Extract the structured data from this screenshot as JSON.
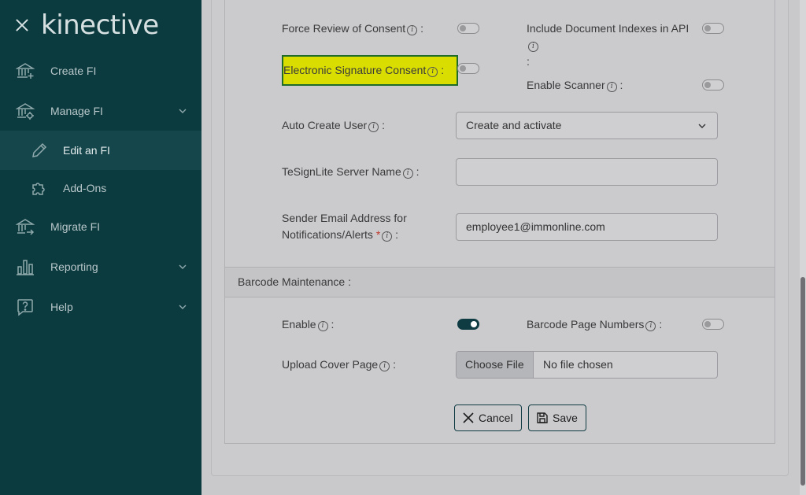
{
  "sidebar": {
    "logo": "kinective",
    "items": [
      {
        "label": "Create FI"
      },
      {
        "label": "Manage FI"
      },
      {
        "label": "Edit an FI"
      },
      {
        "label": "Add-Ons"
      },
      {
        "label": "Migrate FI"
      },
      {
        "label": "Reporting"
      },
      {
        "label": "Help"
      }
    ]
  },
  "form": {
    "force_review_label": "Force Review of Consent",
    "force_review_enabled": false,
    "include_doc_indexes_label": "Include Document Indexes in API",
    "include_doc_indexes_enabled": false,
    "esig_consent_label": "Electronic Signature Consent",
    "esig_consent_enabled": false,
    "enable_scanner_label": "Enable Scanner",
    "enable_scanner_enabled": false,
    "auto_create_user_label": "Auto Create User",
    "auto_create_user_value": "Create and activate",
    "tesignlite_label": "TeSignLite Server Name",
    "tesignlite_value": "",
    "sender_email_label_line1": "Sender Email Address for",
    "sender_email_label_line2": "Notifications/Alerts",
    "sender_email_value": "employee1@immonline.com",
    "colon": ":",
    "required_mark": "*",
    "info_glyph": "i"
  },
  "barcode": {
    "section_title": "Barcode Maintenance :",
    "enable_label": "Enable",
    "enable_enabled": true,
    "page_numbers_label": "Barcode Page Numbers",
    "page_numbers_enabled": false,
    "upload_cover_label": "Upload Cover Page",
    "choose_file_label": "Choose File",
    "no_file_text": "No file chosen"
  },
  "actions": {
    "cancel_label": "Cancel",
    "save_label": "Save"
  },
  "colors": {
    "sidebar_bg": "#0b3a3f",
    "accent": "#0e3c42",
    "highlight": "#d9de00"
  }
}
